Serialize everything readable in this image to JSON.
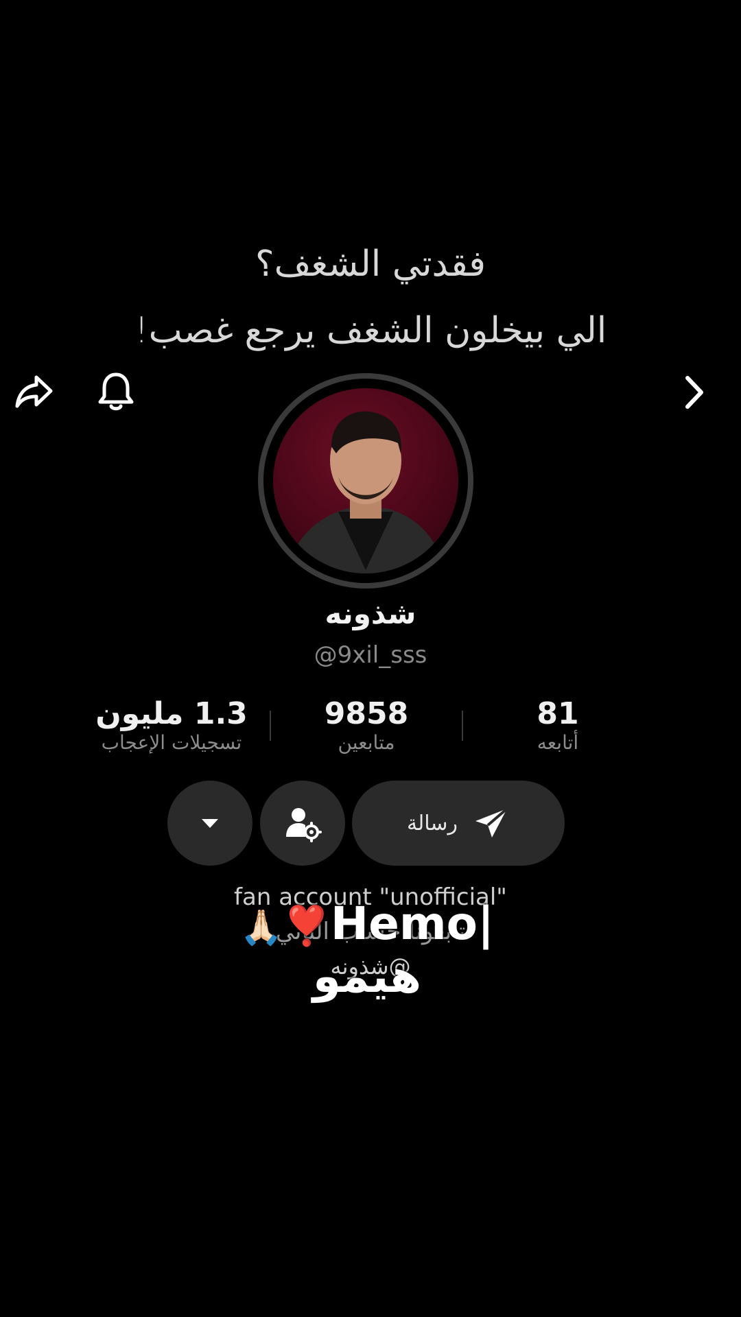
{
  "caption": {
    "line1": "فقدتي الشغف؟",
    "line2": "الي بيخلون الشغف يرجع غصب!"
  },
  "top_bar": {
    "share_icon": "share-arrow-icon",
    "bell_icon": "bell-icon",
    "next_icon": "chevron-right-icon"
  },
  "profile": {
    "display_name": "شذونه",
    "handle": "@9xil_sss"
  },
  "stats": [
    {
      "value": "1.3 مليون",
      "label": "تسجيلات الإعجاب"
    },
    {
      "value": "9858",
      "label": "متابعين"
    },
    {
      "value": "81",
      "label": "أتابعه"
    }
  ],
  "actions": {
    "message_label": "رسالة",
    "message_icon": "send-icon",
    "friend_icon": "person-settings-icon",
    "more_icon": "caret-down-icon"
  },
  "bio": {
    "line1": "fan account \"unofficial\"",
    "line2": "تابعونا حساب الثاني",
    "line3": "@شذونه"
  },
  "overlay_text": {
    "latin": "Hemo",
    "arabic": "هيمو",
    "separator": "|",
    "heart": "❣️",
    "hands": "🙏🏻"
  },
  "colors": {
    "background": "#000000",
    "button_bg": "#2a2a2a",
    "avatar_bg": "#4a0718"
  }
}
